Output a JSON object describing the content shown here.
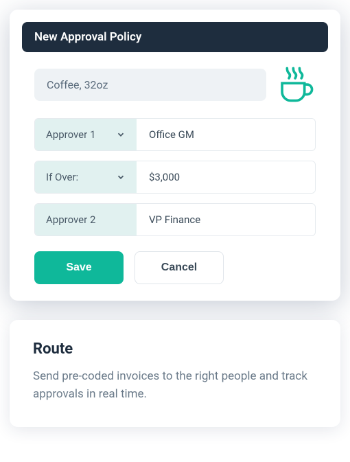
{
  "policy": {
    "header": "New Approval Policy",
    "item_name": "Coffee, 32oz",
    "rows": [
      {
        "label": "Approver 1",
        "value": "Office GM",
        "chevron": true
      },
      {
        "label": "If Over:",
        "value": "$3,000",
        "chevron": true
      },
      {
        "label": "Approver 2",
        "value": "VP Finance",
        "chevron": false
      }
    ],
    "save_label": "Save",
    "cancel_label": "Cancel"
  },
  "route": {
    "title": "Route",
    "description": "Send pre-coded invoices to the right people and track approvals in real time."
  }
}
